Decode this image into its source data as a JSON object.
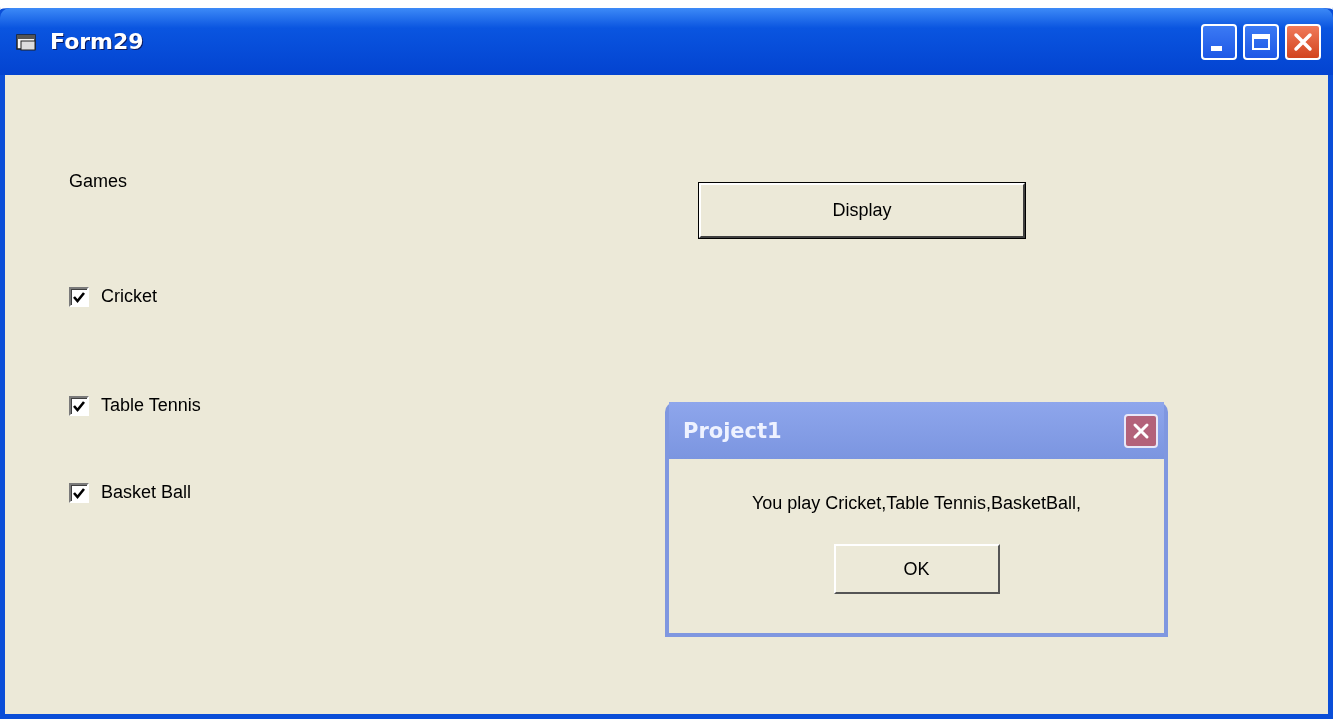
{
  "window": {
    "title": "Form29"
  },
  "games_label": "Games",
  "checkboxes": [
    {
      "label": "Cricket",
      "checked": true
    },
    {
      "label": "Table Tennis",
      "checked": true
    },
    {
      "label": "Basket Ball",
      "checked": true
    }
  ],
  "display_button": "Display",
  "dialog": {
    "title": "Project1",
    "message": "You play Cricket,Table Tennis,BasketBall,",
    "button": "OK"
  }
}
